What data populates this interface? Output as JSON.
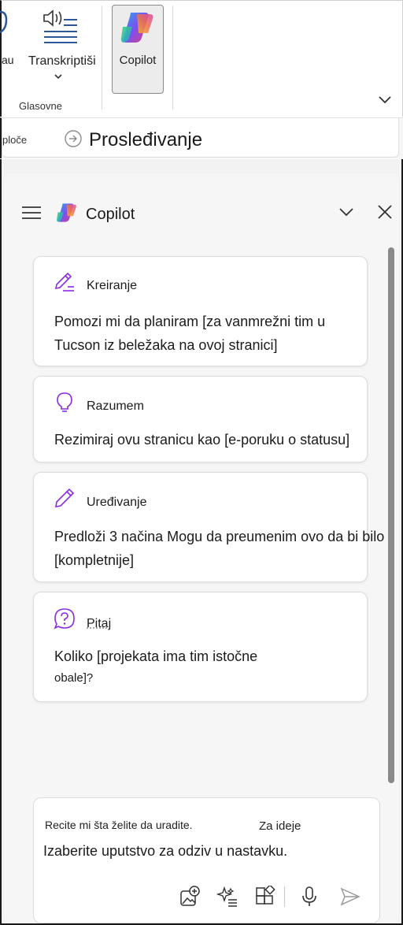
{
  "ribbon": {
    "partial_label": "au",
    "transcribe_label": "Transkriptiši",
    "group_label": "Glasovne",
    "copilot_label": "Copilot"
  },
  "forward_bar": {
    "left_text": "ploče",
    "title": "Prosleđivanje"
  },
  "pane": {
    "title": "Copilot"
  },
  "cards": [
    {
      "label": "Kreiranje",
      "icon": "pencil-writing-icon",
      "lines": [
        "Pomozi mi da planiram [za vanmrežni tim u",
        "Tucson iz beležaka na ovoj stranici]"
      ]
    },
    {
      "label": "Razumem",
      "icon": "lightbulb-icon",
      "lines": [
        "Rezimiraj ovu stranicu kao [e-poruku o statusu]"
      ]
    },
    {
      "label": "Uređivanje",
      "icon": "pencil-icon",
      "lines": [
        "Predloži 3 načina  Mogu da preumenim ovo da bi bilo",
        "[kompletnije]"
      ]
    },
    {
      "label": "Pitaj",
      "icon": "question-bubble-icon",
      "lines": [
        "Koliko [projekata ima tim istočne",
        "obale]?"
      ]
    }
  ],
  "input": {
    "placeholder_small": "Recite mi šta želite da uradite.",
    "ideas_label": "Za ideje",
    "placeholder_main": "Izaberite uputstvo za odziv u nastavku."
  },
  "colors": {
    "accent_purple": "#8a2be2",
    "tool_purple": "#6b2fa0"
  }
}
